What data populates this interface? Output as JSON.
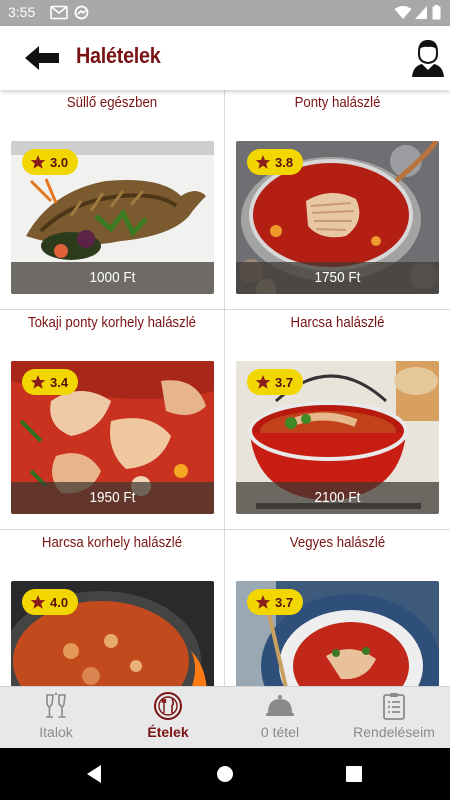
{
  "status_bar": {
    "time": "3:55"
  },
  "header": {
    "title": "Halételek"
  },
  "dishes": [
    {
      "name": "Süllő egészben",
      "rating": "3.0",
      "price": "1000 Ft"
    },
    {
      "name": "Ponty halászlé",
      "rating": "3.8",
      "price": "1750 Ft"
    },
    {
      "name": "Tokaji ponty korhely halászlé",
      "rating": "3.4",
      "price": "1950 Ft"
    },
    {
      "name": "Harcsa halászlé",
      "rating": "3.7",
      "price": "2100 Ft"
    },
    {
      "name": "Harcsa korhely halászlé",
      "rating": "4.0",
      "price": ""
    },
    {
      "name": "Vegyes halászlé",
      "rating": "3.7",
      "price": ""
    }
  ],
  "bottom_nav": {
    "items": [
      {
        "label": "Italok",
        "icon": "wine-glasses-icon"
      },
      {
        "label": "Ételek",
        "icon": "plate-cutlery-icon"
      },
      {
        "label": "0 tétel",
        "icon": "cloche-icon"
      },
      {
        "label": "Rendeléseim",
        "icon": "clipboard-list-icon"
      }
    ],
    "active": "Ételek"
  },
  "colors": {
    "accent": "#7a1414",
    "rating_badge": "#f2d600",
    "nav_background": "#e8e8e8",
    "status_bar": "#a8a8a8"
  }
}
